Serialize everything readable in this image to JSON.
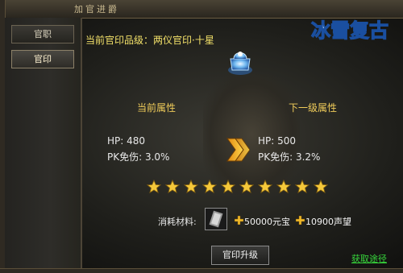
{
  "window": {
    "title": "加官进爵"
  },
  "logo": {
    "text": "冰雪复古"
  },
  "sidebar": {
    "tabs": [
      {
        "label": "官职"
      },
      {
        "label": "官印"
      }
    ]
  },
  "rank": {
    "current_label": "当前官印品级：两仪官印·十星"
  },
  "current": {
    "title": "当前属性",
    "hp": "HP: 480",
    "pk": "PK免伤: 3.0%"
  },
  "next": {
    "title": "下一级属性",
    "hp": "HP: 500",
    "pk": "PK免伤: 3.2%"
  },
  "stars": {
    "count": 10,
    "filled": 10,
    "color": "#f5c83a"
  },
  "cost": {
    "label": "消耗材料:",
    "gold": "50000元宝",
    "prestige": "10900声望"
  },
  "buttons": {
    "upgrade": "官印升级"
  },
  "links": {
    "get_source": "获取途径"
  },
  "colors": {
    "accent_yellow": "#f4e26a",
    "link_green": "#37d83c",
    "title_gold": "#f0cc5a"
  }
}
